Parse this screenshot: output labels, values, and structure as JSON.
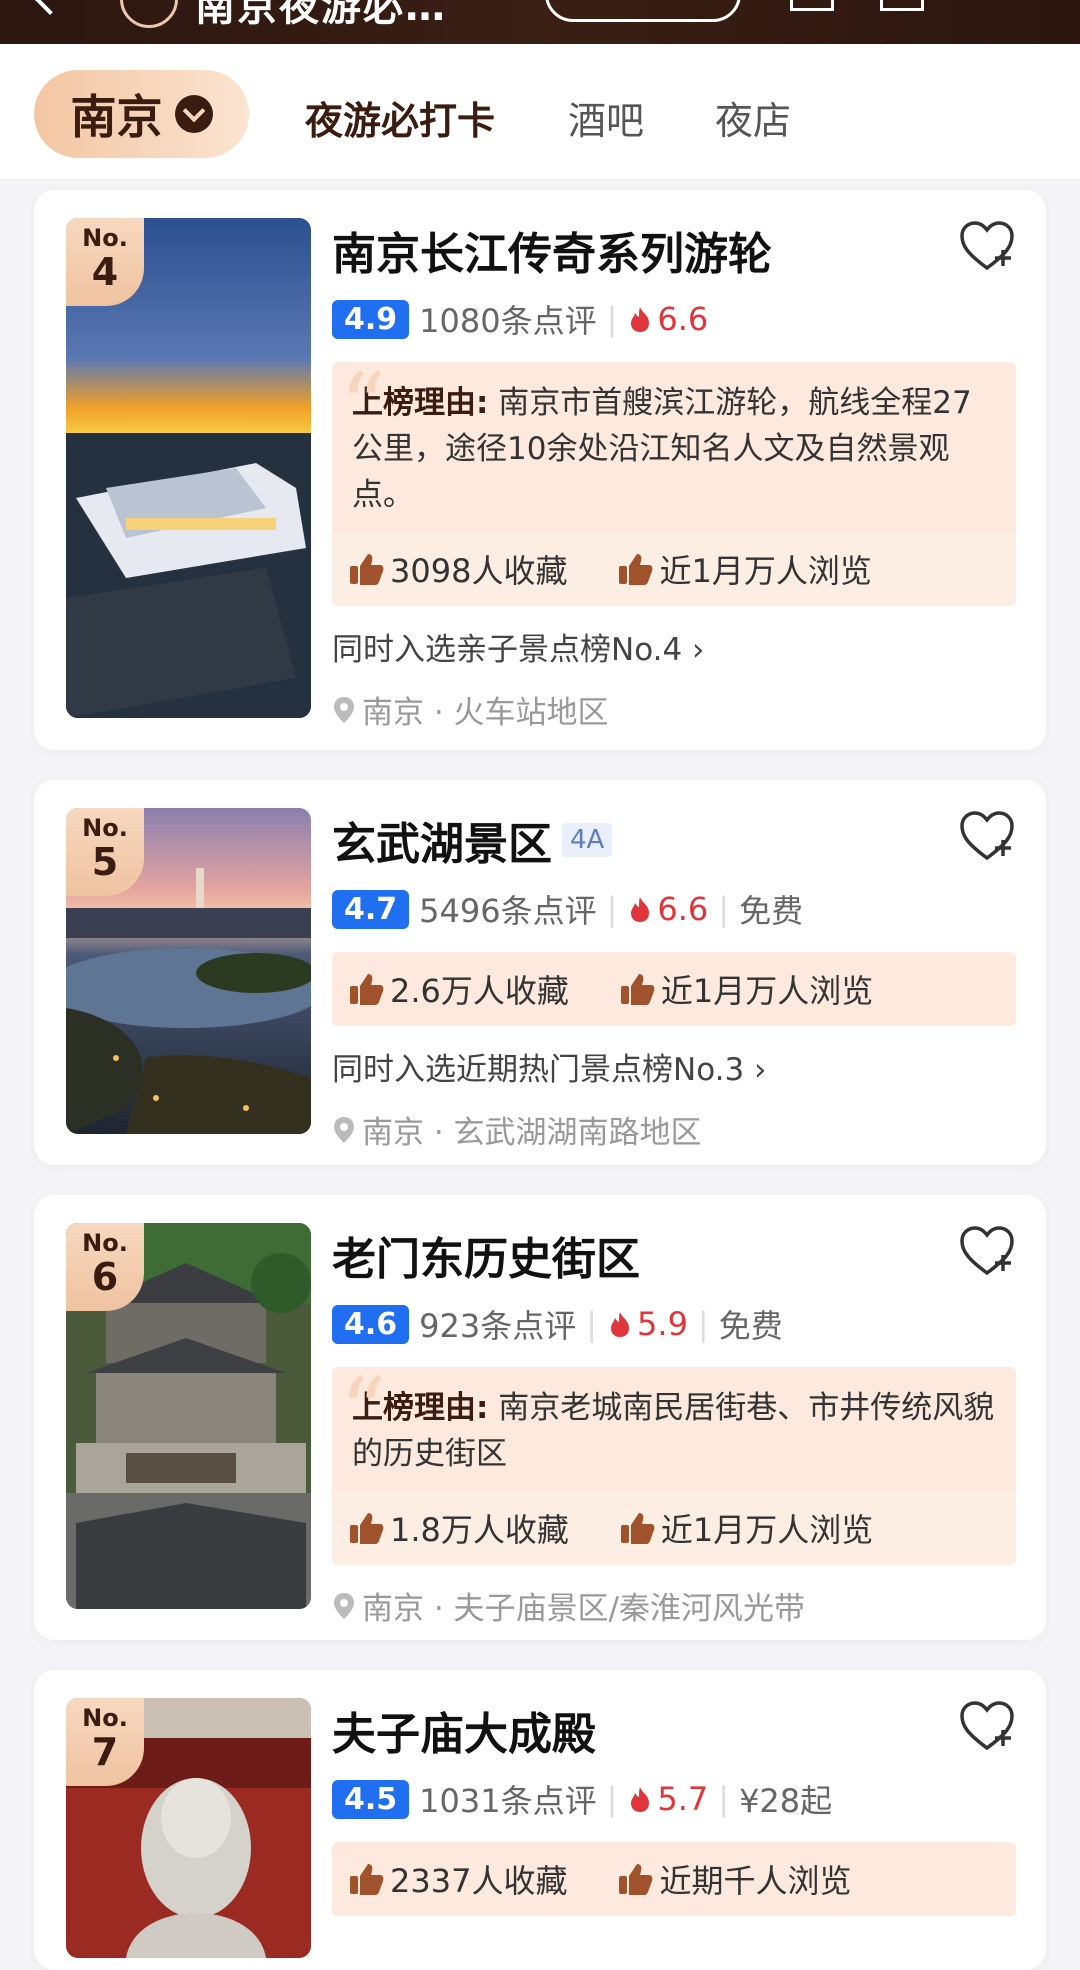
{
  "header": {
    "title": "南京夜游必…"
  },
  "filters": {
    "city": "南京",
    "tabs": [
      "夜游必打卡",
      "酒吧",
      "夜店"
    ]
  },
  "colors": {
    "accent": "#1f6ff0",
    "hot": "#e0353a",
    "rank_badge": "#f3cba9",
    "reason_bg": "#fde9dd"
  },
  "items": [
    {
      "rank_label": "No.",
      "rank": "4",
      "name": "南京长江传奇系列游轮",
      "score": "4.9",
      "reviews": "1080条点评",
      "hot": "6.6",
      "reason_label": "上榜理由:",
      "reason_text": "南京市首艘滨江游轮，航线全程27公里，途径10余处沿江知名人文及自然景观点。",
      "stat1": "3098人收藏",
      "stat2": "近1月万人浏览",
      "also": "同时入选亲子景点榜No.4 ›",
      "location": "南京 · 火车站地区"
    },
    {
      "rank_label": "No.",
      "rank": "5",
      "name": "玄武湖景区",
      "badge": "4A",
      "score": "4.7",
      "reviews": "5496条点评",
      "hot": "6.6",
      "price": "免费",
      "stat1": "2.6万人收藏",
      "stat2": "近1月万人浏览",
      "also": "同时入选近期热门景点榜No.3 ›",
      "location": "南京 · 玄武湖湖南路地区"
    },
    {
      "rank_label": "No.",
      "rank": "6",
      "name": "老门东历史街区",
      "score": "4.6",
      "reviews": "923条点评",
      "hot": "5.9",
      "price": "免费",
      "reason_label": "上榜理由:",
      "reason_text": "南京老城南民居街巷、市井传统风貌的历史街区",
      "stat1": "1.8万人收藏",
      "stat2": "近1月万人浏览",
      "location": "南京 · 夫子庙景区/秦淮河风光带"
    },
    {
      "rank_label": "No.",
      "rank": "7",
      "name": "夫子庙大成殿",
      "score": "4.5",
      "reviews": "1031条点评",
      "hot": "5.7",
      "price": "¥28起",
      "stat1": "2337人收藏",
      "stat2": "近期千人浏览"
    }
  ]
}
